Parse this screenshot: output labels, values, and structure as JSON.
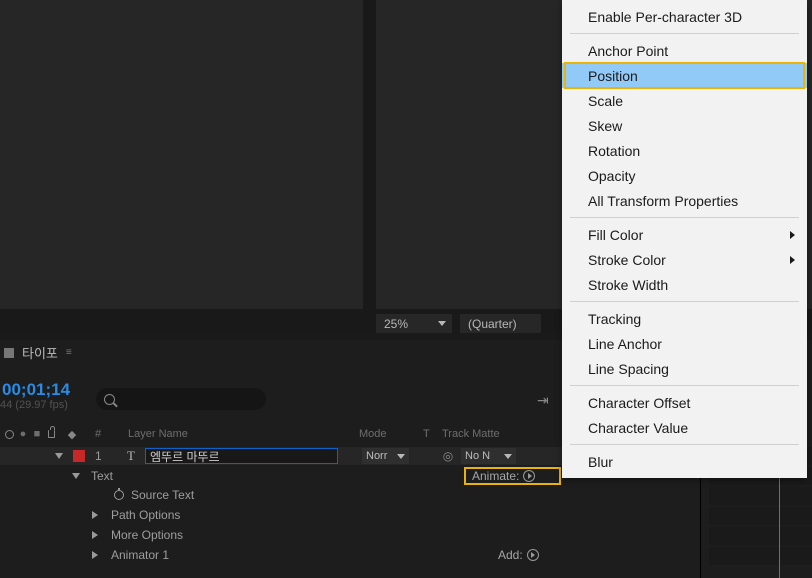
{
  "preview": {
    "zoom": "25%",
    "resolution": "(Quarter)"
  },
  "timeline": {
    "tab": "타이포",
    "timecode": "00;01;14",
    "fps": "44 (29.97 fps)",
    "headers": {
      "hash": "#",
      "layer_name": "Layer Name",
      "mode": "Mode",
      "t": "T",
      "track_matte": "Track Matte"
    },
    "layer": {
      "index": "1",
      "type_glyph": "T",
      "name": "엠뚜르 마뚜르",
      "mode": "Norr",
      "matte": "No N"
    },
    "subrows": {
      "text": "Text",
      "source_text": "Source Text",
      "path_options": "Path Options",
      "more_options": "More Options",
      "animator1": "Animator 1"
    },
    "animate_label": "Animate:",
    "add_label": "Add:"
  },
  "menu": {
    "items1": [
      "Enable Per-character 3D"
    ],
    "items2": [
      "Anchor Point",
      "Position",
      "Scale",
      "Skew",
      "Rotation",
      "Opacity",
      "All Transform Properties"
    ],
    "items3": [
      {
        "label": "Fill Color",
        "sub": true
      },
      {
        "label": "Stroke Color",
        "sub": true
      },
      {
        "label": "Stroke Width",
        "sub": false
      }
    ],
    "items4": [
      "Tracking",
      "Line Anchor",
      "Line Spacing"
    ],
    "items5": [
      "Character Offset",
      "Character Value"
    ],
    "items6": [
      "Blur"
    ],
    "selected": "Position"
  }
}
